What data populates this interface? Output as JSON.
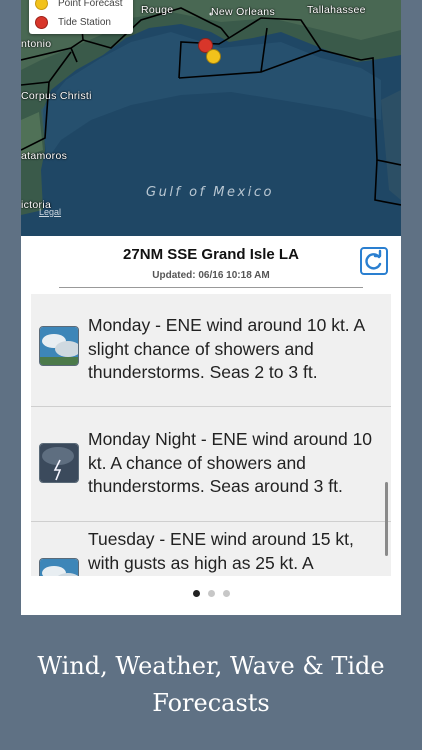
{
  "map": {
    "legend": [
      {
        "label": "Point Forecast",
        "color": "#f2c21b"
      },
      {
        "label": "Tide Station",
        "color": "#d8362a"
      }
    ],
    "cities": {
      "rouge": "Rouge",
      "new_orleans": "New Orleans",
      "tallahassee": "Tallahassee",
      "antonio": "ntonio",
      "corpus_christi": "Corpus Christi",
      "matamoros": "atamoros",
      "victoria": "ictoria"
    },
    "gulf": "Gulf of Mexico",
    "legal": "Legal"
  },
  "header": {
    "title": "27NM SSE Grand Isle LA",
    "updated": "Updated: 06/16 10:18 AM"
  },
  "forecasts": [
    {
      "icon": "cloudy-sky-icon",
      "text": "Monday - ENE wind around 10 kt. A slight chance of showers and thunderstorms.   Seas 2 to 3 ft."
    },
    {
      "icon": "thunderstorm-icon",
      "text": "Monday Night - ENE wind around 10 kt. A chance of showers and thunderstorms.   Seas around 3 ft."
    },
    {
      "icon": "cloudy-sky-icon",
      "text": "Tuesday - ENE wind around 15 kt, with gusts as high as 25 kt. A"
    }
  ],
  "pager": {
    "count": 3,
    "active": 1
  },
  "caption": {
    "line1": "Wind, Weather, Wave & Tide",
    "line2": "Forecasts"
  }
}
